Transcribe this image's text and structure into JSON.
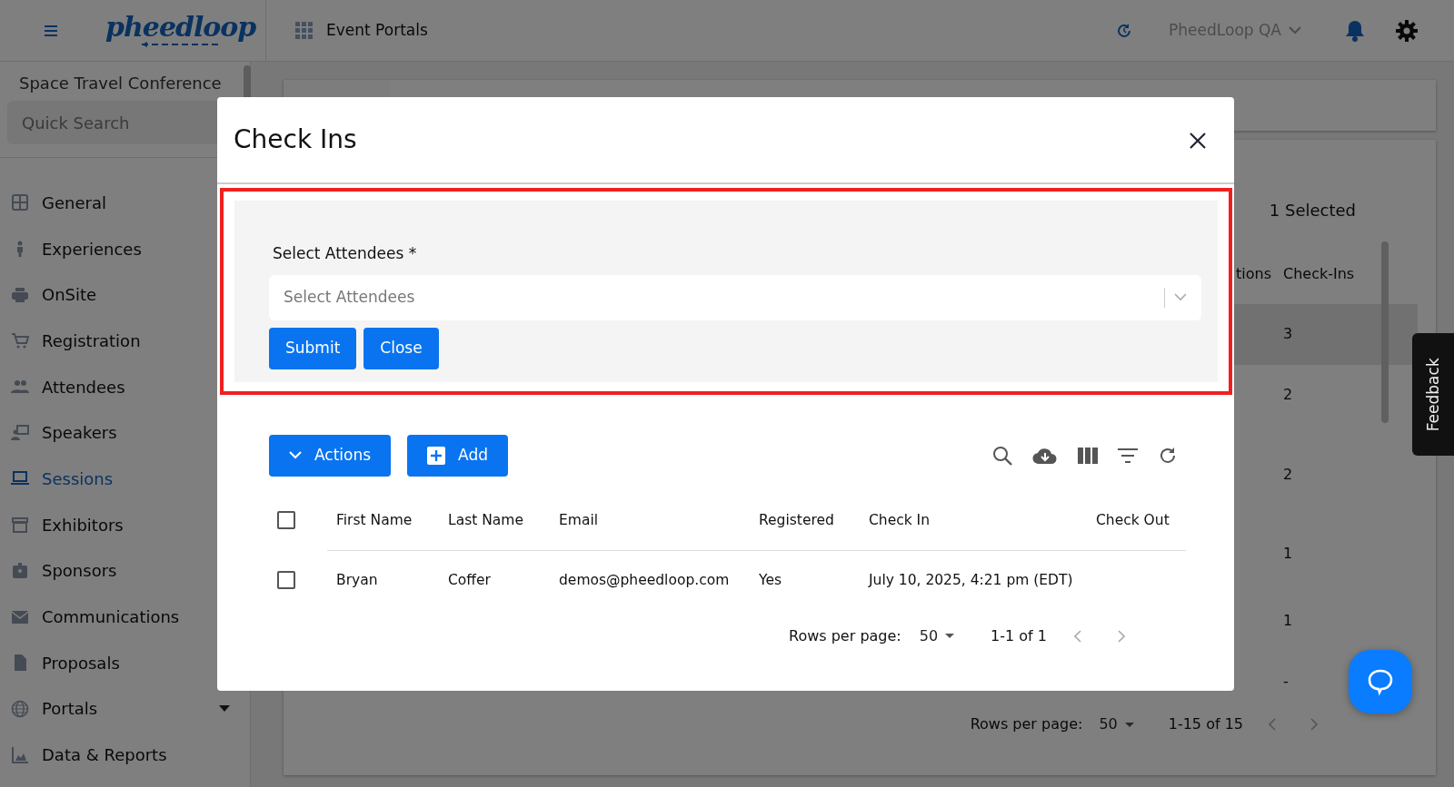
{
  "topbar": {
    "logo": "pheedloop",
    "app_menu": "Event Portals",
    "account": "PheedLoop QA"
  },
  "sidebar": {
    "event_name": "Space Travel Conference",
    "search": {
      "placeholder": "Quick Search"
    },
    "items": [
      {
        "label": "General",
        "selected": false,
        "expandable": false
      },
      {
        "label": "Experiences",
        "selected": false,
        "expandable": false
      },
      {
        "label": "OnSite",
        "selected": false,
        "expandable": false
      },
      {
        "label": "Registration",
        "selected": false,
        "expandable": false
      },
      {
        "label": "Attendees",
        "selected": false,
        "expandable": false
      },
      {
        "label": "Speakers",
        "selected": false,
        "expandable": false
      },
      {
        "label": "Sessions",
        "selected": true,
        "expandable": false
      },
      {
        "label": "Exhibitors",
        "selected": false,
        "expandable": false
      },
      {
        "label": "Sponsors",
        "selected": false,
        "expandable": false
      },
      {
        "label": "Communications",
        "selected": false,
        "expandable": false
      },
      {
        "label": "Proposals",
        "selected": false,
        "expandable": false
      },
      {
        "label": "Portals",
        "selected": false,
        "expandable": true
      },
      {
        "label": "Data & Reports",
        "selected": false,
        "expandable": false
      }
    ]
  },
  "background_table": {
    "selection_count": "1 Selected",
    "columns": [
      "tions",
      "Check-Ins"
    ],
    "rows": [
      {
        "check_ins": "3",
        "selected": true
      },
      {
        "check_ins": "2",
        "selected": false
      },
      {
        "check_ins": "2",
        "selected": false
      },
      {
        "check_ins": "1",
        "selected": false
      },
      {
        "check_ins": "1",
        "selected": false
      },
      {
        "check_ins": "-",
        "selected": false
      }
    ],
    "pagination": {
      "label": "Rows per page:",
      "rows_per_page": "50",
      "range": "1-15 of 15"
    }
  },
  "feedback_tab": "Feedback",
  "dialog": {
    "title": "Check Ins",
    "form": {
      "label": "Select Attendees *",
      "placeholder": "Select Attendees",
      "buttons": [
        "Submit",
        "Close"
      ]
    },
    "toolbar": [
      {
        "label": "Actions",
        "kind": "dropdown"
      },
      {
        "label": "Add",
        "kind": "add"
      }
    ],
    "table": {
      "header_checked": false,
      "columns": [
        "First Name",
        "Last Name",
        "Email",
        "Registered",
        "Check In",
        "Check Out"
      ],
      "rows": [
        {
          "checked": false,
          "cells": [
            "Bryan",
            "Coffer",
            "demos@pheedloop.com",
            "Yes",
            "July 10, 2025, 4:21 pm (EDT)"
          ]
        }
      ]
    },
    "pagination": {
      "label": "Rows per page:",
      "rows_per_page": "50",
      "range": "1-1 of 1"
    }
  }
}
